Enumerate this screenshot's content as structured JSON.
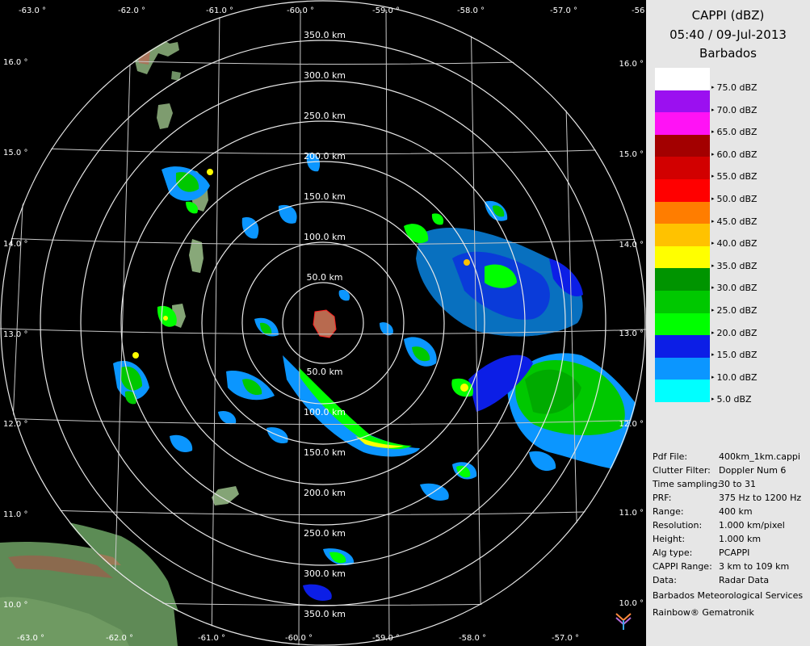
{
  "header": {
    "product": "CAPPI (dBZ)",
    "datetime": "05:40 / 09-Jul-2013",
    "site": "Barbados"
  },
  "legend": [
    {
      "color": "#ffffff",
      "label": "75.0 dBZ"
    },
    {
      "color": "#9b10f0",
      "label": "70.0 dBZ"
    },
    {
      "color": "#ff12f5",
      "label": "65.0 dBZ"
    },
    {
      "color": "#a30000",
      "label": "60.0 dBZ"
    },
    {
      "color": "#d20000",
      "label": "55.0 dBZ"
    },
    {
      "color": "#ff0000",
      "label": "50.0 dBZ"
    },
    {
      "color": "#ff7d00",
      "label": "45.0 dBZ"
    },
    {
      "color": "#ffc200",
      "label": "40.0 dBZ"
    },
    {
      "color": "#ffff00",
      "label": "35.0 dBZ"
    },
    {
      "color": "#009400",
      "label": "30.0 dBZ"
    },
    {
      "color": "#00c800",
      "label": "25.0 dBZ"
    },
    {
      "color": "#00ff00",
      "label": "20.0 dBZ"
    },
    {
      "color": "#0c1ee6",
      "label": "15.0 dBZ"
    },
    {
      "color": "#0b96ff",
      "label": "10.0 dBZ"
    },
    {
      "color": "#00ffff",
      "label": "5.0 dBZ"
    }
  ],
  "metadata": [
    {
      "key": "Pdf File:",
      "value": "400km_1km.cappi"
    },
    {
      "key": "Clutter Filter:",
      "value": "Doppler Num 6"
    },
    {
      "key": "Time sampling:",
      "value": "30 to 31"
    },
    {
      "key": "PRF:",
      "value": "375 Hz to 1200 Hz"
    },
    {
      "key": "Range:",
      "value": "400 km"
    },
    {
      "key": "Resolution:",
      "value": "1.000 km/pixel"
    },
    {
      "key": "Height:",
      "value": "1.000 km"
    },
    {
      "key": "Alg type:",
      "value": "PCAPPI"
    },
    {
      "key": "CAPPI Range:",
      "value": "3 km to 109 km"
    },
    {
      "key": "Data:",
      "value": "Radar Data"
    }
  ],
  "footer": {
    "organization": "Barbados Meteorological Services",
    "credit": "Rainbow® Gematronik"
  },
  "range_rings_upper": [
    "50.0 km",
    "100.0 km",
    "150.0 km",
    "200.0 km",
    "250.0 km",
    "300.0 km",
    "350.0 km"
  ],
  "range_rings_lower": [
    "50.0 km",
    "100.0 km",
    "150.0 km",
    "200.0 km",
    "250.0 km",
    "300.0 km",
    "350.0 km"
  ],
  "longitude_labels": [
    "-63.0 °",
    "-62.0 °",
    "-61.0 °",
    "-60.0 °",
    "-59.0 °",
    "-58.0 °",
    "-57.0 °",
    "-56"
  ],
  "longitude_labels_bottom": [
    "-63.0 °",
    "-62.0 °",
    "-61.0 °",
    "-60.0 °",
    "-59.0 °",
    "-58.0 °",
    "-57.0 °"
  ],
  "latitude_labels_left": [
    "16.0 °",
    "15.0 °",
    "14.0 °",
    "13.0 °",
    "12.0 °",
    "11.0 °",
    "10.0 °"
  ],
  "latitude_labels_right": [
    "16.0 °",
    "15.0 °",
    "14.0 °",
    "13.0 °",
    "12.0 °",
    "11.0 °",
    "10.0 °"
  ]
}
